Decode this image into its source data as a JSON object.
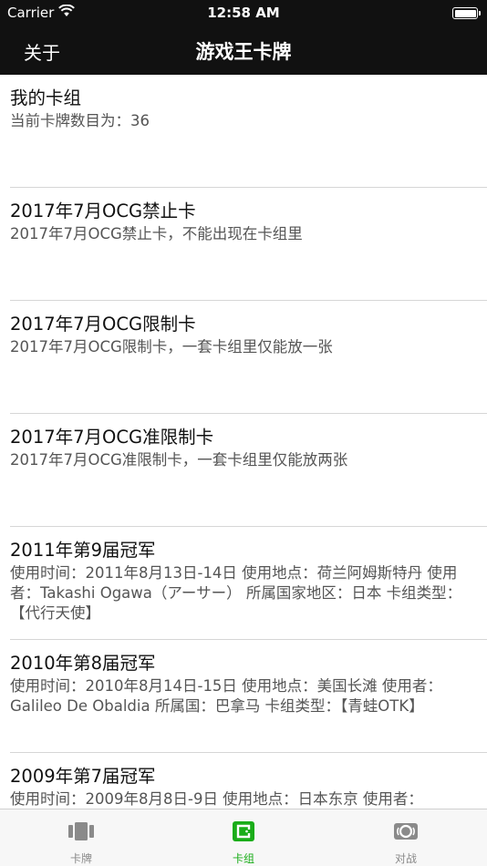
{
  "status_bar": {
    "carrier": "Carrier",
    "time": "12:58 AM"
  },
  "nav": {
    "about": "关于",
    "title": "游戏王卡牌"
  },
  "items": [
    {
      "title": "我的卡组",
      "desc": "当前卡牌数目为：36"
    },
    {
      "title": "2017年7月OCG禁止卡",
      "desc": "2017年7月OCG禁止卡，不能出现在卡组里"
    },
    {
      "title": "2017年7月OCG限制卡",
      "desc": "2017年7月OCG限制卡，一套卡组里仅能放一张"
    },
    {
      "title": "2017年7月OCG准限制卡",
      "desc": "2017年7月OCG准限制卡，一套卡组里仅能放两张"
    },
    {
      "title": "2011年第9届冠军",
      "desc": "使用时间：2011年8月13日-14日 使用地点：荷兰阿姆斯特丹 使用者：Takashi Ogawa（アーサー） 所属国家地区：日本 卡组类型：【代行天使】"
    },
    {
      "title": "2010年第8届冠军",
      "desc": "使用时间：2010年8月14日-15日 使用地点：美国长滩 使用者：Galileo De Obaldia 所属国：巴拿马 卡组类型：【青蛙OTK】"
    },
    {
      "title": "2009年第7届冠军",
      "desc": "使用时间：2009年8月8日-9日 使用地点：日本东京 使用者："
    }
  ],
  "tabs": [
    {
      "label": "卡牌",
      "icon": "cards-icon"
    },
    {
      "label": "卡组",
      "icon": "deck-wallet-icon"
    },
    {
      "label": "对战",
      "icon": "battle-icon"
    }
  ],
  "colors": {
    "accent": "#1aad19",
    "tab_inactive": "#8a8a8a",
    "bar_bg": "#111111"
  },
  "selected_tab": 1
}
